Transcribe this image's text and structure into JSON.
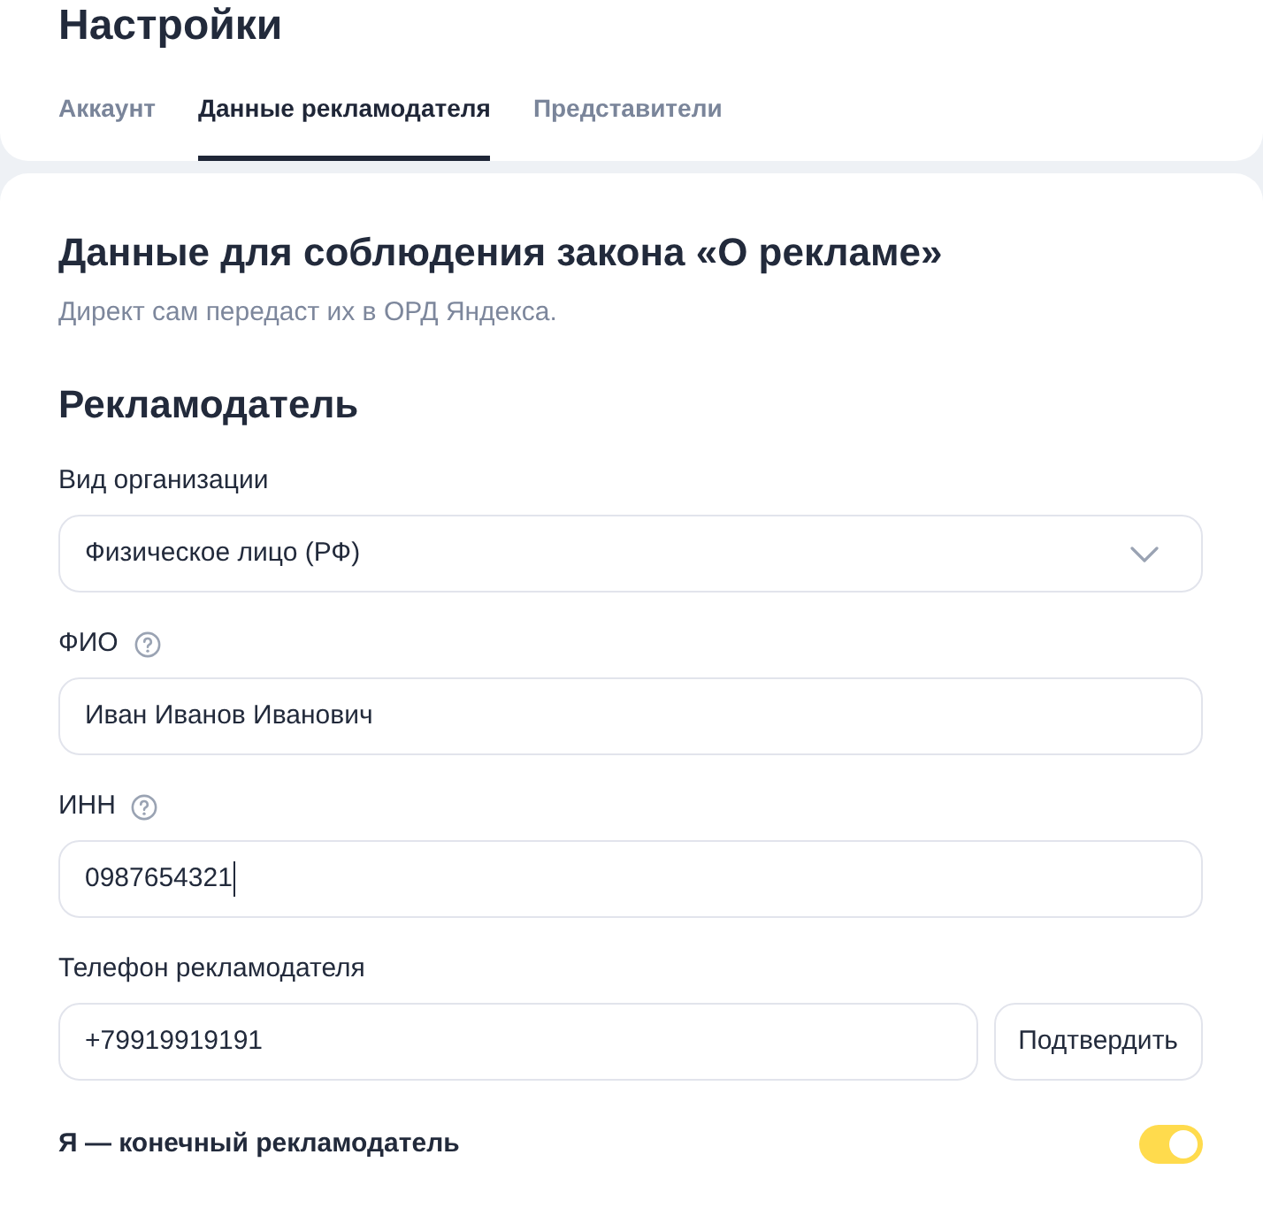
{
  "page": {
    "title": "Настройки"
  },
  "tabs": [
    {
      "label": "Аккаунт",
      "selected": false
    },
    {
      "label": "Данные рекламодателя",
      "selected": true
    },
    {
      "label": "Представители",
      "selected": false
    }
  ],
  "section": {
    "title": "Данные для соблюдения закона «О рекламе»",
    "subtitle": "Директ сам передаст их в ОРД Яндекса."
  },
  "advertiser": {
    "title": "Рекламодатель",
    "fields": [
      {
        "kind": "select",
        "label": "Вид организации",
        "help": false,
        "value": "Физическое лицо (РФ)",
        "focused": false
      },
      {
        "kind": "text",
        "label": "ФИО",
        "help": true,
        "value": "Иван Иванов Иванович",
        "focused": false
      },
      {
        "kind": "text",
        "label": "ИНН",
        "help": true,
        "value": "0987654321",
        "focused": true
      },
      {
        "kind": "phone",
        "label": "Телефон рекламодателя",
        "help": false,
        "value": "+79919919191",
        "focused": false,
        "button": "Подтвердить"
      }
    ],
    "toggle": {
      "label": "Я — конечный рекламодатель",
      "on": true
    }
  }
}
